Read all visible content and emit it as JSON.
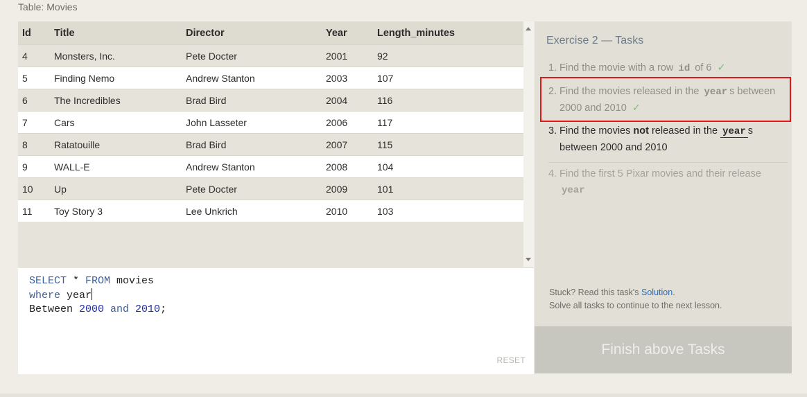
{
  "table_caption": "Table: Movies",
  "results": {
    "columns": [
      "Id",
      "Title",
      "Director",
      "Year",
      "Length_minutes"
    ],
    "rows": [
      [
        "4",
        "Monsters, Inc.",
        "Pete Docter",
        "2001",
        "92"
      ],
      [
        "5",
        "Finding Nemo",
        "Andrew Stanton",
        "2003",
        "107"
      ],
      [
        "6",
        "The Incredibles",
        "Brad Bird",
        "2004",
        "116"
      ],
      [
        "7",
        "Cars",
        "John Lasseter",
        "2006",
        "117"
      ],
      [
        "8",
        "Ratatouille",
        "Brad Bird",
        "2007",
        "115"
      ],
      [
        "9",
        "WALL-E",
        "Andrew Stanton",
        "2008",
        "104"
      ],
      [
        "10",
        "Up",
        "Pete Docter",
        "2009",
        "101"
      ],
      [
        "11",
        "Toy Story 3",
        "Lee Unkrich",
        "2010",
        "103"
      ]
    ]
  },
  "editor": {
    "line1": {
      "kw1": "SELECT",
      "mid": " * ",
      "kw2": "FROM",
      "rest": " movies"
    },
    "line2": {
      "kw": "where",
      "rest": " year"
    },
    "line3": {
      "start": "Between ",
      "num1": "2000",
      "kw": " and ",
      "num2": "2010",
      "end": ";"
    },
    "reset_label": "RESET"
  },
  "tasks_panel": {
    "title": "Exercise 2 — Tasks",
    "tasks": [
      {
        "number": "1.",
        "a": "Find the movie with a row",
        "code": "id",
        "b": "of 6",
        "check": "✓"
      },
      {
        "number": "2.",
        "a": "Find the movies released in the",
        "code": "year",
        "b": "s between 2000 and 2010",
        "check": "✓"
      },
      {
        "number": "3.",
        "a": "Find the movies",
        "strong": "not",
        "b": "released in the",
        "code": "year",
        "c": "s between 2000 and 2010"
      },
      {
        "number": "4.",
        "a": "Find the first 5 Pixar movies and their release",
        "code": "year"
      }
    ],
    "help": {
      "stuck": "Stuck? Read this task's",
      "link": "Solution",
      "period": ".",
      "line2": "Solve all tasks to continue to the next lesson."
    },
    "finish_label": "Finish above Tasks"
  },
  "colors": {
    "highlight_border": "#e4161b",
    "check": "#7fbd7b",
    "link": "#2a6cc0"
  }
}
